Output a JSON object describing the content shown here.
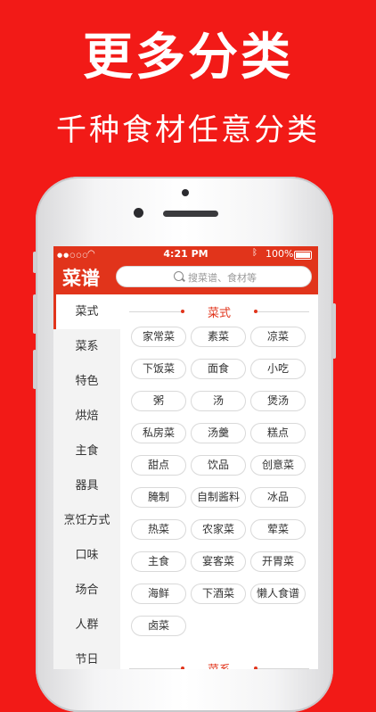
{
  "promo": {
    "headline": "更多分类",
    "subline": "千种食材任意分类"
  },
  "status_bar": {
    "signal": "●●○○○",
    "time": "4:21 PM",
    "battery": "100%"
  },
  "nav": {
    "title": "菜谱",
    "search_placeholder": "搜菜谱、食材等"
  },
  "sidebar": {
    "items": [
      {
        "label": "菜式",
        "active": true
      },
      {
        "label": "菜系"
      },
      {
        "label": "特色"
      },
      {
        "label": "烘焙"
      },
      {
        "label": "主食"
      },
      {
        "label": "器具"
      },
      {
        "label": "烹饪方式"
      },
      {
        "label": "口味"
      },
      {
        "label": "场合"
      },
      {
        "label": "人群"
      },
      {
        "label": "节日"
      }
    ]
  },
  "sections": [
    {
      "title": "菜式",
      "tags": [
        "家常菜",
        "素菜",
        "凉菜",
        "下饭菜",
        "面食",
        "小吃",
        "粥",
        "汤",
        "煲汤",
        "私房菜",
        "汤羹",
        "糕点",
        "甜点",
        "饮品",
        "创意菜",
        "腌制",
        "自制酱料",
        "冰品",
        "热菜",
        "农家菜",
        "荤菜",
        "主食",
        "宴客菜",
        "开胃菜",
        "海鲜",
        "下酒菜",
        "懒人食谱",
        "卤菜"
      ]
    },
    {
      "title": "菜系",
      "tags": []
    }
  ],
  "colors": {
    "background": "#f21a17",
    "accent": "#e1341b"
  }
}
